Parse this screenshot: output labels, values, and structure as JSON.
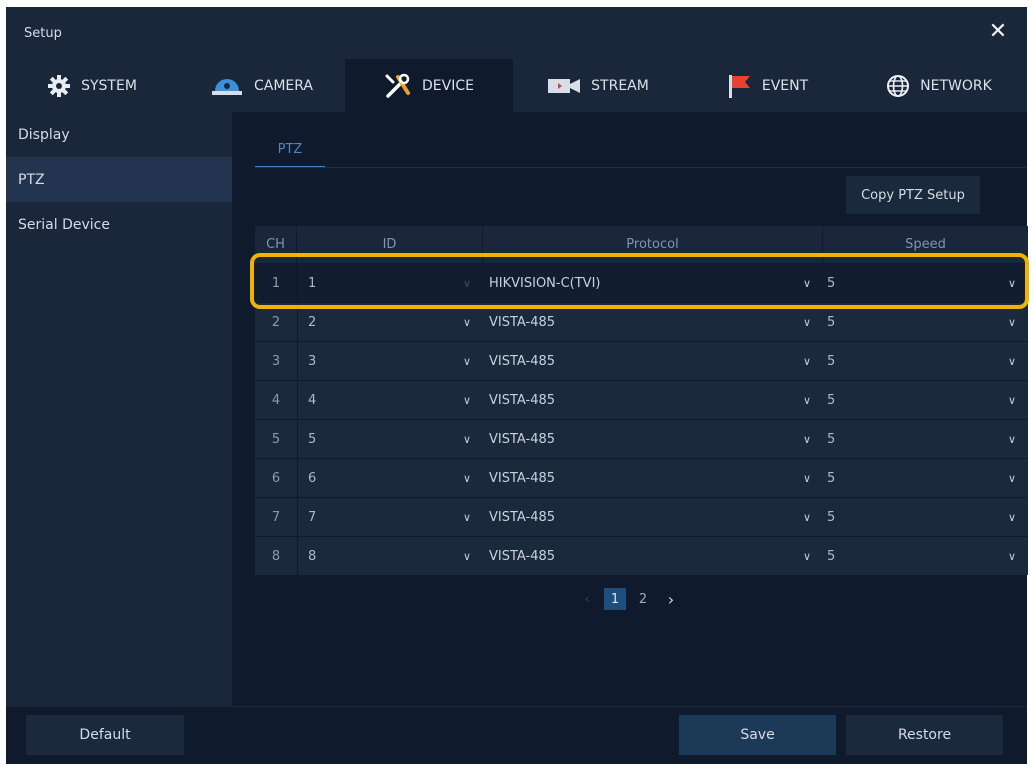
{
  "window": {
    "title": "Setup",
    "close_icon": "close-icon"
  },
  "tabs": [
    {
      "label": "SYSTEM",
      "icon": "gear-icon"
    },
    {
      "label": "CAMERA",
      "icon": "dome-camera-icon"
    },
    {
      "label": "DEVICE",
      "icon": "tools-icon"
    },
    {
      "label": "STREAM",
      "icon": "video-camera-icon"
    },
    {
      "label": "EVENT",
      "icon": "flag-icon"
    },
    {
      "label": "NETWORK",
      "icon": "globe-icon"
    }
  ],
  "active_tab": "DEVICE",
  "sidebar": {
    "items": [
      {
        "label": "Display"
      },
      {
        "label": "PTZ"
      },
      {
        "label": "Serial Device"
      }
    ],
    "active": "PTZ"
  },
  "subtab": {
    "label": "PTZ"
  },
  "copy_button": {
    "label": "Copy PTZ Setup"
  },
  "table": {
    "headers": {
      "ch": "CH",
      "id": "ID",
      "protocol": "Protocol",
      "speed": "Speed"
    },
    "rows": [
      {
        "ch": "1",
        "id": "1",
        "protocol": "HIKVISION-C(TVI)",
        "speed": "5"
      },
      {
        "ch": "2",
        "id": "2",
        "protocol": "VISTA-485",
        "speed": "5"
      },
      {
        "ch": "3",
        "id": "3",
        "protocol": "VISTA-485",
        "speed": "5"
      },
      {
        "ch": "4",
        "id": "4",
        "protocol": "VISTA-485",
        "speed": "5"
      },
      {
        "ch": "5",
        "id": "5",
        "protocol": "VISTA-485",
        "speed": "5"
      },
      {
        "ch": "6",
        "id": "6",
        "protocol": "VISTA-485",
        "speed": "5"
      },
      {
        "ch": "7",
        "id": "7",
        "protocol": "VISTA-485",
        "speed": "5"
      },
      {
        "ch": "8",
        "id": "8",
        "protocol": "VISTA-485",
        "speed": "5"
      }
    ]
  },
  "pagination": {
    "pages": [
      "1",
      "2"
    ],
    "current": "1",
    "prev": "‹",
    "next": "›"
  },
  "bottom": {
    "default_label": "Default",
    "save_label": "Save",
    "restore_label": "Restore"
  },
  "colors": {
    "highlight": "#f0b400",
    "accent": "#3f82c8",
    "background": "#0f1a2d",
    "panel": "#1a2639"
  }
}
